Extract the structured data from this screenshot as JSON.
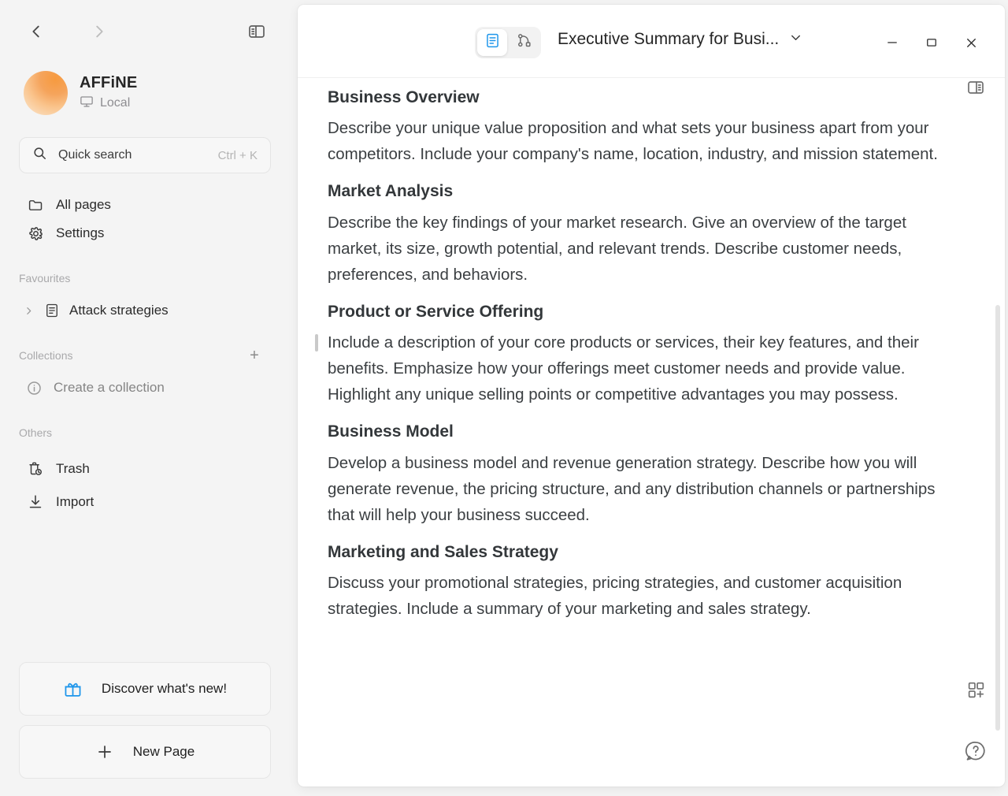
{
  "sidebar": {
    "nav_back": "back-arrow",
    "nav_forward": "forward-arrow",
    "panel_toggle": "sidebar-toggle-icon",
    "workspace": {
      "name": "AFFiNE",
      "sync_status": "Local"
    },
    "search": {
      "label": "Quick search",
      "shortcut": "Ctrl + K"
    },
    "primary_items": [
      {
        "label": "All pages",
        "icon": "folder-icon"
      },
      {
        "label": "Settings",
        "icon": "gear-icon"
      }
    ],
    "favourites": {
      "title": "Favourites",
      "items": [
        {
          "label": "Attack strategies",
          "icon": "doc-icon"
        }
      ]
    },
    "collections": {
      "title": "Collections",
      "add_label": "+",
      "empty_label": "Create a collection"
    },
    "others": {
      "title": "Others",
      "items": [
        {
          "label": "Trash",
          "icon": "trash-clock-icon"
        },
        {
          "label": "Import",
          "icon": "download-icon"
        }
      ]
    },
    "bottom_buttons": [
      {
        "label": "Discover what's new!",
        "icon": "gift-icon",
        "accent": "#1e96eb"
      },
      {
        "label": "New Page",
        "icon": "plus-icon"
      }
    ]
  },
  "window": {
    "mode_page_icon": "page-mode-icon",
    "mode_edgeless_icon": "edgeless-mode-icon",
    "active_mode": "page",
    "doc_title": "Executive Summary for Busi...",
    "title_chevron": "chevron-down-icon",
    "controls": {
      "minimize": "minimize-icon",
      "maximize": "maximize-icon",
      "close": "close-icon"
    },
    "right_panel_toggle": "right-sidebar-toggle-icon"
  },
  "document": {
    "blocks": [
      {
        "type": "h3",
        "text": "Business Overview"
      },
      {
        "type": "p",
        "text": "Describe your unique value proposition and what sets your business apart from your competitors. Include your company's name, location, industry, and mission statement."
      },
      {
        "type": "h3",
        "text": "Market Analysis"
      },
      {
        "type": "p",
        "text": "Describe the key findings of your market research. Give an overview of the target market, its size, growth potential, and relevant trends. Describe customer needs, preferences, and behaviors."
      },
      {
        "type": "h3",
        "text": "Product or Service Offering"
      },
      {
        "type": "p",
        "text": "Include a description of your core products or services, their key features, and their benefits. Emphasize how your offerings meet customer needs and provide value. Highlight any unique selling points or competitive advantages you may possess.",
        "handle": true
      },
      {
        "type": "h3",
        "text": "Business Model"
      },
      {
        "type": "p",
        "text": "Develop a business model and revenue generation strategy. Describe how you will generate revenue, the pricing structure, and any distribution channels or partnerships that will help your business succeed."
      },
      {
        "type": "h3",
        "text": "Marketing and Sales Strategy"
      },
      {
        "type": "p",
        "text": "Discuss your promotional strategies, pricing strategies, and customer acquisition strategies. Include a summary of your marketing and sales strategy."
      }
    ],
    "tools": [
      {
        "icon": "add-widget-icon"
      },
      {
        "icon": "help-bubble-icon"
      }
    ]
  },
  "colors": {
    "accent_blue": "#1e96eb",
    "sidebar_bg": "#f4f4f4",
    "window_bg": "#ffffff",
    "text_primary": "#2b2b2b",
    "text_muted": "#a9a9ab"
  }
}
